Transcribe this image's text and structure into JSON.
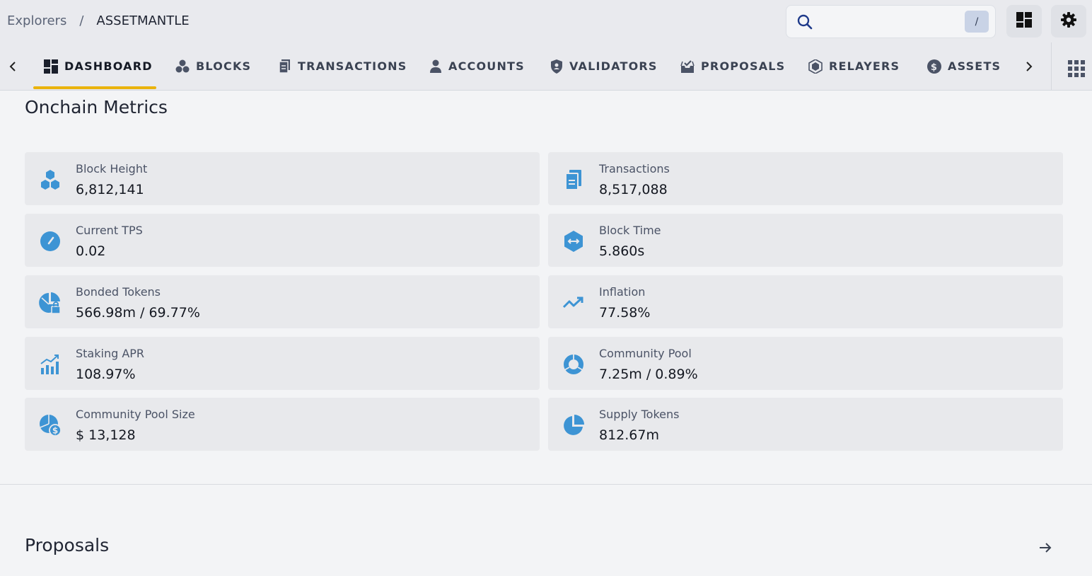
{
  "breadcrumb": {
    "root": "Explorers",
    "separator": "/",
    "current": "ASSETMANTLE"
  },
  "search": {
    "placeholder": "",
    "shortcut": "/",
    "icon": "search-icon"
  },
  "header_buttons": {
    "layout_icon": "dashboard-layout-icon",
    "settings_icon": "gear-icon"
  },
  "tabs": [
    {
      "label": "DASHBOARD",
      "icon": "dashboard-icon",
      "active": true
    },
    {
      "label": "BLOCKS",
      "icon": "blocks-icon",
      "active": false
    },
    {
      "label": "TRANSACTIONS",
      "icon": "document-icon",
      "active": false
    },
    {
      "label": "ACCOUNTS",
      "icon": "user-icon",
      "active": false
    },
    {
      "label": "VALIDATORS",
      "icon": "shield-icon",
      "active": false
    },
    {
      "label": "PROPOSALS",
      "icon": "inbox-icon",
      "active": false
    },
    {
      "label": "RELAYERS",
      "icon": "hexagon-icon",
      "active": false
    },
    {
      "label": "ASSETS",
      "icon": "dollar-icon",
      "active": false
    }
  ],
  "metrics": {
    "title": "Onchain Metrics",
    "items": [
      {
        "label": "Block Height",
        "value": "6,812,141",
        "icon": "cubes-icon"
      },
      {
        "label": "Transactions",
        "value": "8,517,088",
        "icon": "document-icon"
      },
      {
        "label": "Current TPS",
        "value": "0.02",
        "icon": "speedometer-icon"
      },
      {
        "label": "Block Time",
        "value": "5.860s",
        "icon": "hexagon-arrows-icon"
      },
      {
        "label": "Bonded Tokens",
        "value": "566.98m / 69.77%",
        "icon": "pie-lock-icon"
      },
      {
        "label": "Inflation",
        "value": "77.58%",
        "icon": "trending-up-icon"
      },
      {
        "label": "Staking APR",
        "value": "108.97%",
        "icon": "chart-growth-icon"
      },
      {
        "label": "Community Pool",
        "value": "7.25m / 0.89%",
        "icon": "donut-icon"
      },
      {
        "label": "Community Pool Size",
        "value": "$ 13,128",
        "icon": "pie-dollar-icon"
      },
      {
        "label": "Supply Tokens",
        "value": "812.67m",
        "icon": "pie-chart-icon"
      }
    ]
  },
  "proposals": {
    "title": "Proposals",
    "arrow_icon": "arrow-right-icon"
  },
  "colors": {
    "accent": "#eab30c",
    "icon_blue": "#3d94d4",
    "card_bg": "#e8e9ec"
  }
}
